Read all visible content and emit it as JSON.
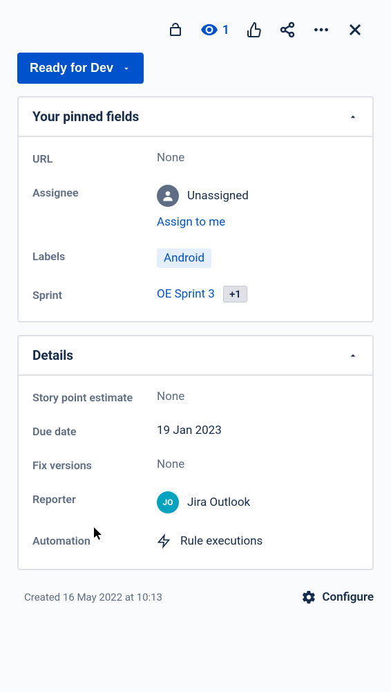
{
  "toolbar": {
    "watch_count": "1"
  },
  "status": {
    "label": "Ready for Dev"
  },
  "pinned": {
    "title": "Your pinned fields",
    "url": {
      "label": "URL",
      "value": "None"
    },
    "assignee": {
      "label": "Assignee",
      "value": "Unassigned",
      "assign_link": "Assign to me"
    },
    "labels": {
      "label": "Labels",
      "value": "Android"
    },
    "sprint": {
      "label": "Sprint",
      "value": "OE Sprint 3",
      "more": "+1"
    }
  },
  "details": {
    "title": "Details",
    "story_points": {
      "label": "Story point estimate",
      "value": "None"
    },
    "due_date": {
      "label": "Due date",
      "value": "19 Jan 2023"
    },
    "fix_versions": {
      "label": "Fix versions",
      "value": "None"
    },
    "reporter": {
      "label": "Reporter",
      "value": "Jira Outlook",
      "initials": "JO"
    },
    "automation": {
      "label": "Automation",
      "value": "Rule executions"
    }
  },
  "footer": {
    "created": "Created 16 May 2022 at 10:13",
    "configure": "Configure"
  }
}
